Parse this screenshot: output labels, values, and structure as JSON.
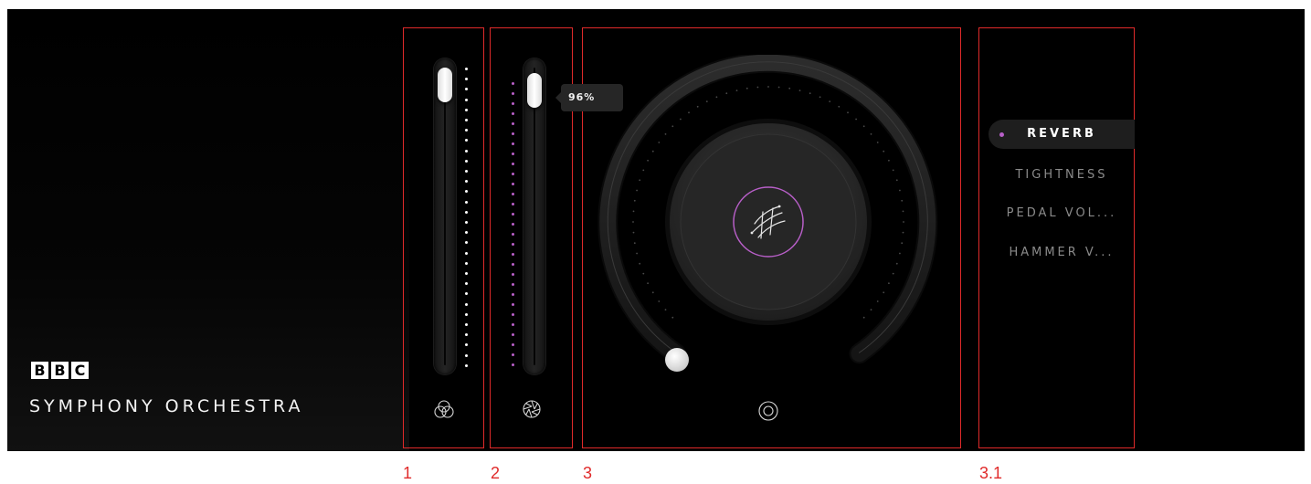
{
  "brand": {
    "logo_letters": [
      "B",
      "B",
      "C"
    ],
    "product_name": "SYMPHONY ORCHESTRA"
  },
  "annotations": [
    "1",
    "2",
    "3",
    "3.1"
  ],
  "slider1": {
    "icon": "venn-circles-icon",
    "value_fraction": 0.98
  },
  "slider2": {
    "icon": "aperture-icon",
    "value_fraction": 0.96,
    "tooltip": "96%"
  },
  "knob": {
    "icon": "target-circle-icon",
    "center_icon": "scribble-stroke-icon",
    "value_fraction": 0.0
  },
  "parameters": {
    "items": [
      {
        "label": "REVERB",
        "active": true
      },
      {
        "label": "TIGHTNESS",
        "active": false
      },
      {
        "label": "PEDAL VOL...",
        "active": false
      },
      {
        "label": "HAMMER V...",
        "active": false
      }
    ]
  },
  "colors": {
    "accent": "#b85fc8",
    "annotation": "#e02a2a",
    "background": "#000000"
  }
}
